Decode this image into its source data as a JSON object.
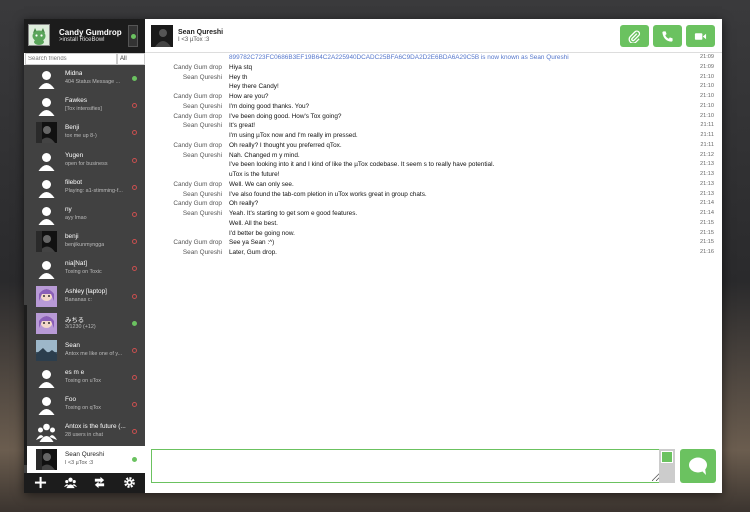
{
  "self": {
    "name": "Candy Gumdrop",
    "status": ">install RiceBowl"
  },
  "search": {
    "placeholder": "Search friends",
    "filter_label": "All"
  },
  "friends": [
    {
      "name": "Midna",
      "status": "404 Status Message ...",
      "online": true,
      "avatar": "default-avatar-icon"
    },
    {
      "name": "Fawkes",
      "status": "[Tox intensifies]",
      "online": false,
      "avatar": "default-avatar-icon"
    },
    {
      "name": "Benji",
      "status": "tox me up 8-)",
      "online": false,
      "avatar": "photo-avatar"
    },
    {
      "name": "Yugen",
      "status": "open for business",
      "online": false,
      "avatar": "default-avatar-icon"
    },
    {
      "name": "filebot",
      "status": "Playing: a1-stimming-f...",
      "online": false,
      "avatar": "default-avatar-icon"
    },
    {
      "name": "ny",
      "status": "ayy lmao",
      "online": false,
      "avatar": "default-avatar-icon"
    },
    {
      "name": "benji",
      "status": "benjikunmyngga",
      "online": false,
      "avatar": "photo-avatar"
    },
    {
      "name": "nia[Nat]",
      "status": "Toxing on Toxic",
      "online": false,
      "avatar": "default-avatar-icon"
    },
    {
      "name": "Ashley [laptop]",
      "status": "Bananas c:",
      "online": false,
      "avatar": "anime-avatar"
    },
    {
      "name": "みちる",
      "status": "3/1230 (+12)",
      "online": true,
      "avatar": "anime-avatar"
    },
    {
      "name": "Sean",
      "status": "Antox me like one of y...",
      "online": false,
      "avatar": "landscape-avatar"
    },
    {
      "name": "es m e",
      "status": "Toxing on uTox",
      "online": false,
      "avatar": "default-avatar-icon"
    },
    {
      "name": "Foo",
      "status": "Toxing on qTox",
      "online": false,
      "avatar": "default-avatar-icon"
    },
    {
      "name": "Antox is the future (...",
      "status": "28 users in chat",
      "online": false,
      "avatar": "group-avatar-icon"
    },
    {
      "name": "Sean Qureshi",
      "status": "I <3 µTox :3",
      "online": true,
      "avatar": "photo-avatar",
      "selected": true
    }
  ],
  "chat": {
    "peer_name": "Sean Qureshi",
    "peer_status": "I <3 µTox :3",
    "messages": [
      {
        "author": "",
        "text": "899782C723FC0686B3EF19B64C2A225940DCADC25BFA6C9DA2D2E6BDA6A29C5B is now known as Sean Qureshi",
        "time": "21:09",
        "action": true
      },
      {
        "author": "Candy Gum drop",
        "text": "Hiya stq",
        "time": "21:09"
      },
      {
        "author": "Sean Qureshi",
        "text": "Hey th",
        "time": "21:10"
      },
      {
        "author": "",
        "text": "Hey there Candy!",
        "time": "21:10"
      },
      {
        "author": "Candy Gum drop",
        "text": "How are you?",
        "time": "21:10"
      },
      {
        "author": "Sean Qureshi",
        "text": "I'm  doing good thanks.  You?",
        "time": "21:10"
      },
      {
        "author": "Candy Gum drop",
        "text": "I've been doing good.  How's Tox going?",
        "time": "21:10"
      },
      {
        "author": "Sean Qureshi",
        "text": "It's great!",
        "time": "21:11"
      },
      {
        "author": "",
        "text": "I'm  using µTox now and I'm  really im pressed.",
        "time": "21:11"
      },
      {
        "author": "Candy Gum drop",
        "text": "Oh really?  I thought you preferred qTox.",
        "time": "21:11"
      },
      {
        "author": "Sean Qureshi",
        "text": "Nah.  Changed m y mind.",
        "time": "21:12"
      },
      {
        "author": "",
        "text": "I've been looking into it and I kind of like the µTox codebase.  It seem s to really have potential.",
        "time": "21:13"
      },
      {
        "author": "",
        "text": "uTox is the future!",
        "time": "21:13"
      },
      {
        "author": "Candy Gum drop",
        "text": "Well.  We can only see.",
        "time": "21:13"
      },
      {
        "author": "Sean Qureshi",
        "text": "I've also found the tab-com pletion in uTox works great in group chats.",
        "time": "21:13"
      },
      {
        "author": "Candy Gum drop",
        "text": "Oh really?",
        "time": "21:14"
      },
      {
        "author": "Sean Qureshi",
        "text": "Yeah.  It's starting to get som e good features.",
        "time": "21:14"
      },
      {
        "author": "",
        "text": "Well.  All the best.",
        "time": "21:15"
      },
      {
        "author": "",
        "text": "I'd better be going now.",
        "time": "21:15"
      },
      {
        "author": "Candy Gum drop",
        "text": "See ya Sean :^)",
        "time": "21:15"
      },
      {
        "author": "Sean Qureshi",
        "text": "Later, Gum drop.",
        "time": "21:16"
      }
    ]
  },
  "composer": {
    "value": ""
  },
  "colors": {
    "accent": "#6bc260",
    "sidebar": "#414141",
    "sidebar_dark": "#1c1c1c",
    "action_text": "#5577cc"
  }
}
